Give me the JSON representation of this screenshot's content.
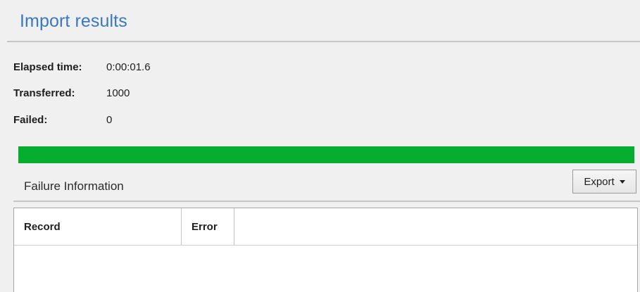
{
  "title": "Import results",
  "stats": {
    "elapsed_label": "Elapsed time:",
    "elapsed_value": "0:00:01.6",
    "transferred_label": "Transferred:",
    "transferred_value": "1000",
    "failed_label": "Failed:",
    "failed_value": "0"
  },
  "progress": {
    "fraction": 1.0,
    "color": "#06ad2e"
  },
  "failure_section": {
    "label": "Failure Information",
    "export_label": "Export"
  },
  "grid": {
    "columns": [
      "Record",
      "Error"
    ],
    "rows": []
  }
}
